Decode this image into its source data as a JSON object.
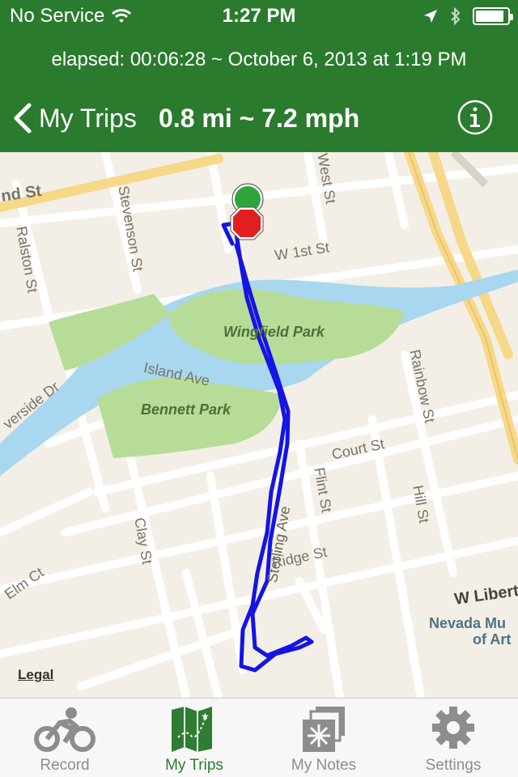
{
  "status_bar": {
    "carrier": "No Service",
    "time": "1:27 PM",
    "battery_level": 0.9
  },
  "trip": {
    "elapsed_line": "elapsed: 00:06:28 ~ October 6, 2013 at 1:19 PM"
  },
  "nav": {
    "back_label": "My Trips",
    "title": "0.8 mi ~ 7.2 mph",
    "info_icon": "info-icon"
  },
  "map": {
    "streets": {
      "second_st_fragment": "nd St",
      "ralston": "Ralston St",
      "stevenson": "Stevenson St",
      "west": "West St",
      "first": "W 1st St",
      "island_ave": "Island Ave",
      "riverside": "verside Dr",
      "rainbow": "Rainbow St",
      "court": "Court St",
      "flint": "Flint St",
      "hill": "Hill St",
      "clay": "Clay St",
      "sterling": "Sterling Ave",
      "ridge": "Ridge St",
      "elm": "Elm Ct",
      "liberty_fragment": "W Libert"
    },
    "parks": {
      "wingfield": "Wingfield Park",
      "bennett": "Bennett Park"
    },
    "poi": {
      "museum_line1": "Nevada Mu",
      "museum_line2": "of Art"
    },
    "legal": "Legal",
    "colors": {
      "route": "#1414e6",
      "water": "#a8d7ef",
      "park": "#b7dc97",
      "major_road": "#f6d889",
      "start_marker": "#2ea53a",
      "end_marker": "#e02020"
    }
  },
  "tabs": [
    {
      "label": "Record",
      "icon": "bicycle-icon",
      "active": false
    },
    {
      "label": "My Trips",
      "icon": "map-icon",
      "active": true
    },
    {
      "label": "My Notes",
      "icon": "notes-icon",
      "active": false
    },
    {
      "label": "Settings",
      "icon": "gear-icon",
      "active": false
    }
  ],
  "theme": {
    "header_green": "#2b7b2e",
    "tab_active": "#2e7d32",
    "tab_inactive": "#8d8d8d"
  }
}
